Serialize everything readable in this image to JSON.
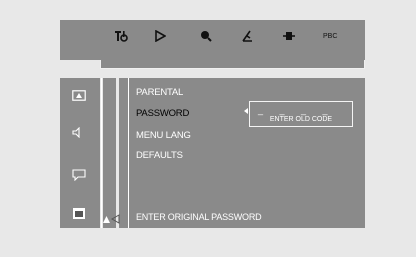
{
  "top_bar": {
    "icons": [
      {
        "name": "audio-settings-icon",
        "glyph": "T"
      },
      {
        "name": "play-icon",
        "glyph": "▷"
      },
      {
        "name": "zoom-icon",
        "glyph": "⊕"
      },
      {
        "name": "angle-icon",
        "glyph": "∠"
      },
      {
        "name": "step-icon",
        "glyph": "·I·"
      },
      {
        "name": "pbc-label",
        "glyph": "PBC"
      }
    ]
  },
  "side_icons": [
    "general-setup-icon",
    "audio-setup-icon",
    "subtitle-icon",
    "preference-icon"
  ],
  "menu": {
    "items": [
      "PARENTAL",
      "PASSWORD",
      "MENU LANG",
      "DEFAULTS"
    ],
    "selected_index": 1
  },
  "password_box": {
    "dashes": "_ _ _ _",
    "hint": "ENTER OLD CODE"
  },
  "status_text": "ENTER ORIGINAL PASSWORD",
  "colors": {
    "panel": "#8a8a8a",
    "background": "#e8e8e8",
    "text": "#ffffff",
    "selected_text": "#000000"
  }
}
